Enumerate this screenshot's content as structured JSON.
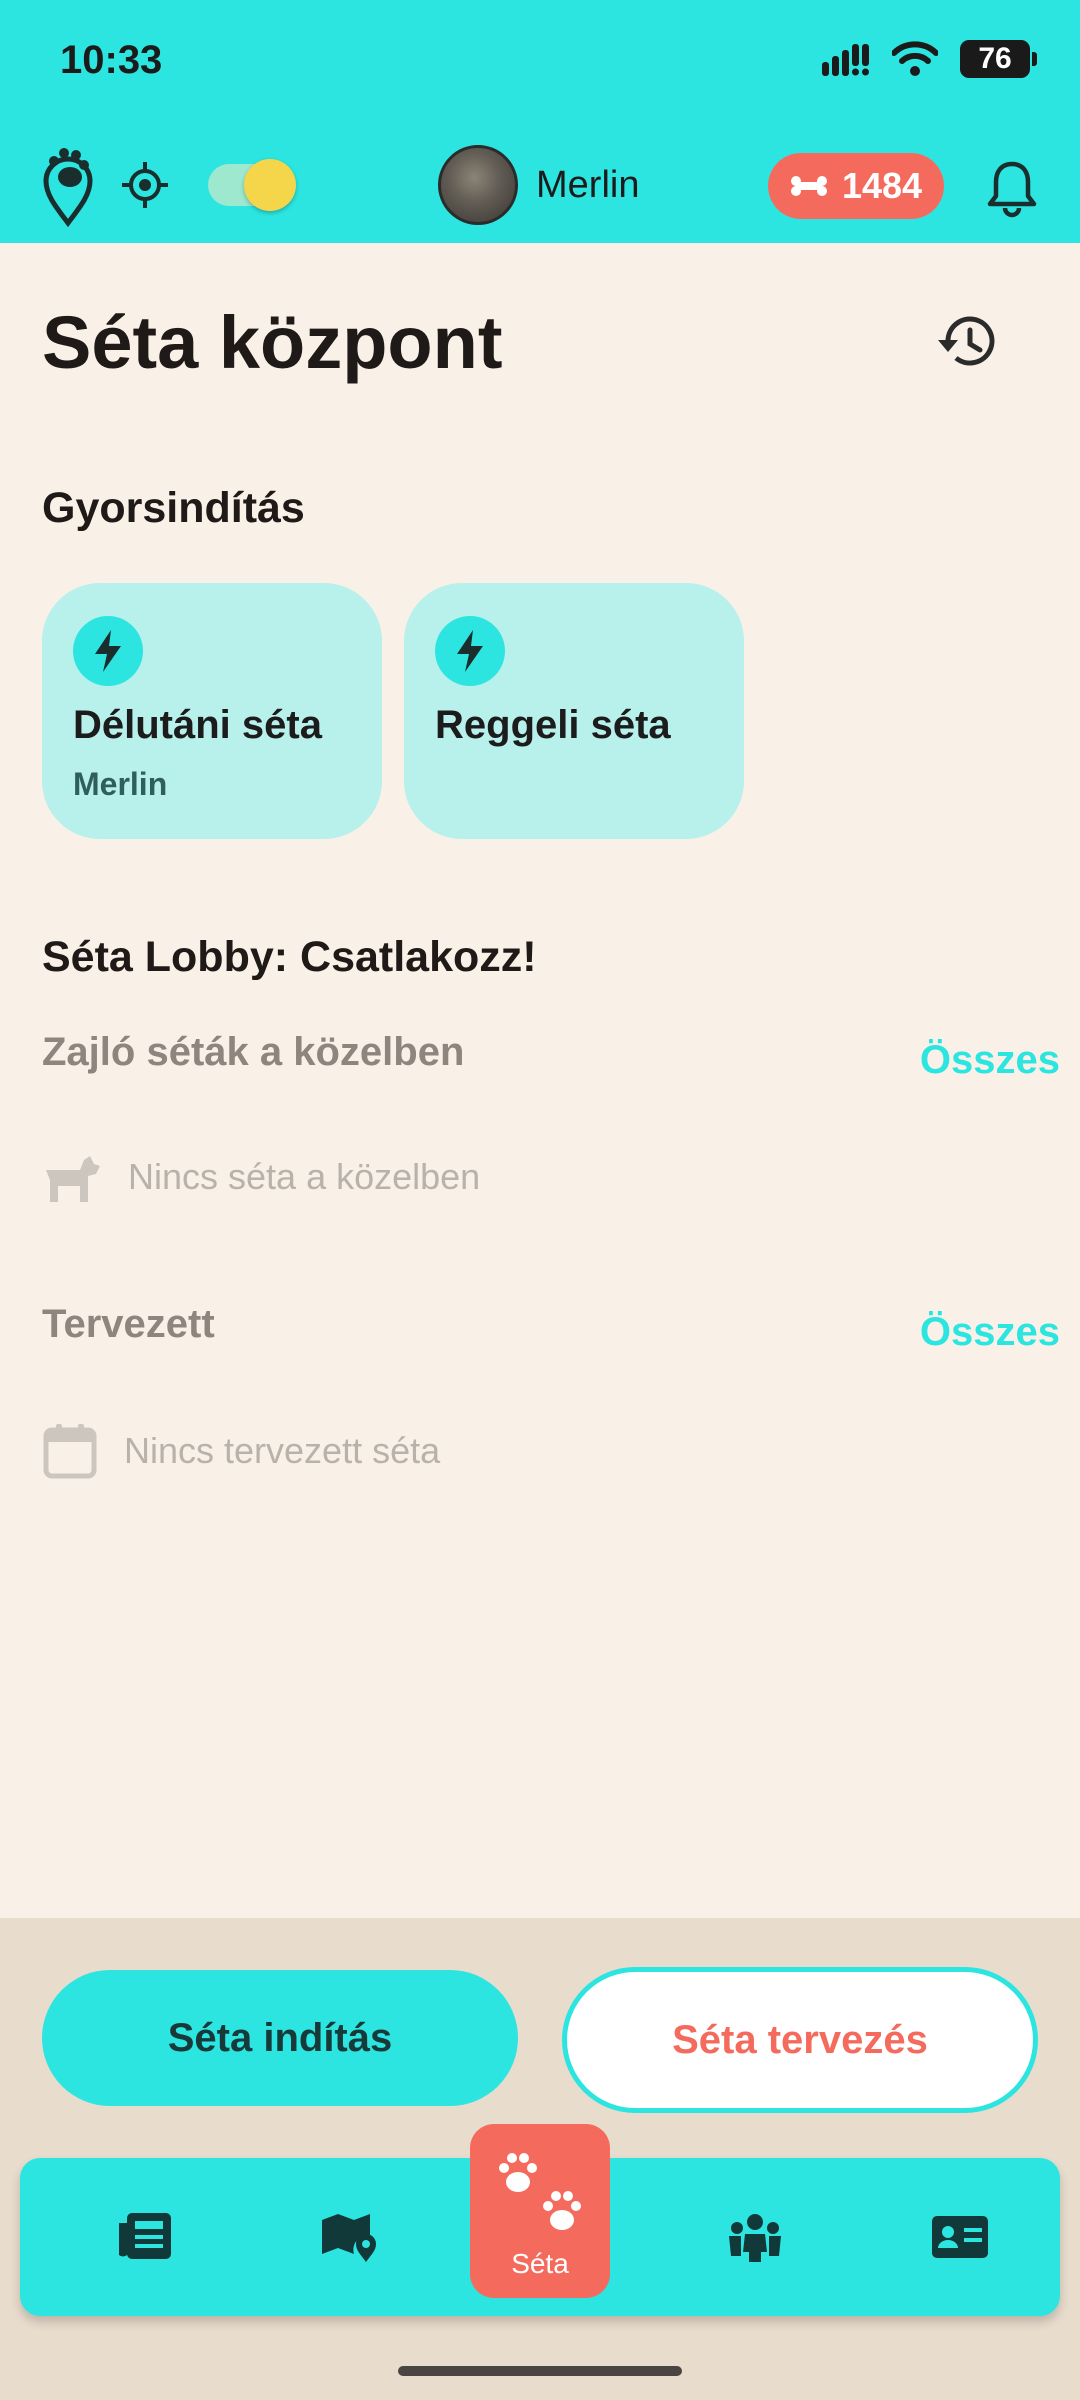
{
  "status": {
    "time": "10:33",
    "battery": "76"
  },
  "header": {
    "dog_name": "Merlin",
    "bones": "1484"
  },
  "page": {
    "title": "Séta központ"
  },
  "quick_start": {
    "title": "Gyorsindítás",
    "cards": [
      {
        "title": "Délutáni séta",
        "subtitle": "Merlin"
      },
      {
        "title": "Reggeli séta",
        "subtitle": ""
      }
    ]
  },
  "lobby": {
    "title": "Séta Lobby: Csatlakozz!",
    "nearby": {
      "title": "Zajló séták a közelben",
      "link": "Összes",
      "empty": "Nincs séta a közelben"
    },
    "planned": {
      "title": "Tervezett",
      "link": "Összes",
      "empty": "Nincs tervezett séta"
    }
  },
  "actions": {
    "start": "Séta indítás",
    "plan": "Séta tervezés"
  },
  "nav": {
    "center_label": "Séta"
  },
  "colors": {
    "primary": "#2ce5e0",
    "accent": "#f46b5d",
    "background": "#f9f1e8"
  }
}
